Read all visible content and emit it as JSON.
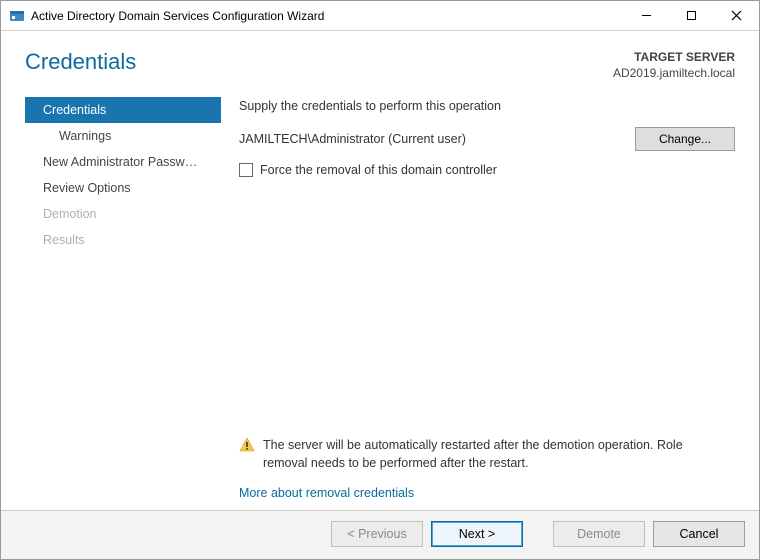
{
  "title": "Active Directory Domain Services Configuration Wizard",
  "page_heading": "Credentials",
  "target": {
    "label": "TARGET SERVER",
    "name": "AD2019.jamiltech.local"
  },
  "sidebar": {
    "items": [
      {
        "label": "Credentials",
        "selected": true,
        "sub": false,
        "disabled": false
      },
      {
        "label": "Warnings",
        "selected": false,
        "sub": true,
        "disabled": false
      },
      {
        "label": "New Administrator Passw…",
        "selected": false,
        "sub": false,
        "disabled": false
      },
      {
        "label": "Review Options",
        "selected": false,
        "sub": false,
        "disabled": false
      },
      {
        "label": "Demotion",
        "selected": false,
        "sub": false,
        "disabled": true
      },
      {
        "label": "Results",
        "selected": false,
        "sub": false,
        "disabled": true
      }
    ]
  },
  "main": {
    "instruction": "Supply the credentials to perform this operation",
    "current_user": "JAMILTECH\\Administrator (Current user)",
    "change_label": "Change...",
    "force_removal_label": "Force the removal of this domain controller",
    "force_removal_checked": false,
    "warning": "The server will be automatically restarted after the demotion operation. Role removal needs to be performed after the restart.",
    "more_link": "More about removal credentials"
  },
  "footer": {
    "previous": "< Previous",
    "next": "Next >",
    "demote": "Demote",
    "cancel": "Cancel"
  }
}
